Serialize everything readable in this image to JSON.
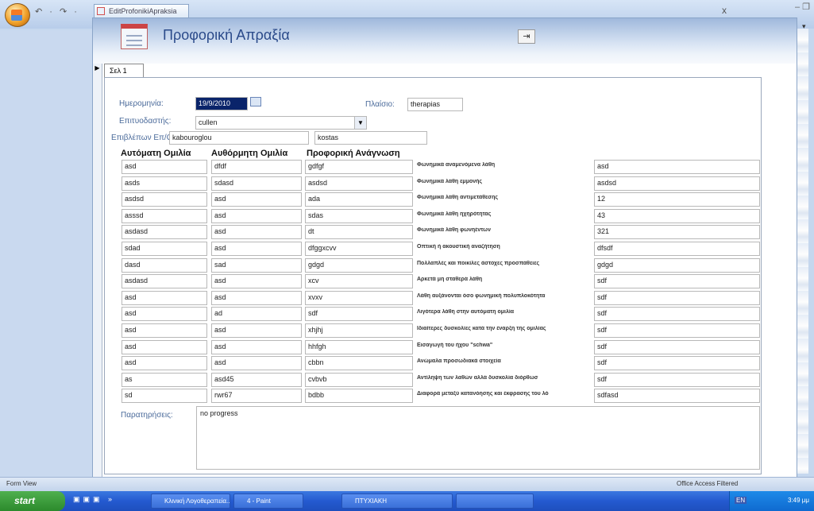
{
  "window": {
    "tab_title": "EditProfonikiApraksia",
    "close": "x"
  },
  "header": {
    "title": "Προφορική Απραξία",
    "exit_glyph": "⇥"
  },
  "page_tab": "Σελ 1",
  "record_marker": "▶",
  "fields": {
    "date_label": "Ημερομηνία:",
    "date_value": "19/9/2010",
    "context_label": "Πλαίσιο:",
    "context_value": "therapias",
    "therapist_label": "Επιτυοδαστής:",
    "therapist_value": "cullen",
    "supervisor_label": "Επιβλέπων Επ/Ον:",
    "supervisor_value_1": "kabouroglou",
    "supervisor_value_2": "kostas"
  },
  "columns": {
    "auto_header": "Αυτόματη Ομιλία",
    "voluntary_header": "Αυθόρμητη Ομιλία",
    "reading_header": "Προφορική Ανάγνωση"
  },
  "rows": [
    {
      "auto": "asd",
      "vol": "dfdf",
      "read": "gdfgf",
      "criterion": "Φωνημικά αναμενόμενα λάθη",
      "value": "asd"
    },
    {
      "auto": "asds",
      "vol": "sdasd",
      "read": "asdsd",
      "criterion": "Φωνημικά λάθη εμμονής",
      "value": "asdsd"
    },
    {
      "auto": "asdsd",
      "vol": "asd",
      "read": "ada",
      "criterion": "Φωνημικά λάθη αντιμετάθεσης",
      "value": "12"
    },
    {
      "auto": "asssd",
      "vol": "asd",
      "read": "sdas",
      "criterion": "Φωνημικά λάθη ηχηρότητας",
      "value": "43"
    },
    {
      "auto": "asdasd",
      "vol": "asd",
      "read": "dt",
      "criterion": "Φωνημικά λάθη φωνηέντων",
      "value": "321"
    },
    {
      "auto": "sdad",
      "vol": "asd",
      "read": "dfggxcvv",
      "criterion": "Οπτική ή ακουστική αναζήτηση",
      "value": "dfsdf"
    },
    {
      "auto": "dasd",
      "vol": "sad",
      "read": "gdgd",
      "criterion": "Πολλαπλές και ποικίλες άστοχες προσπάθειες",
      "value": "gdgd"
    },
    {
      "auto": "asdasd",
      "vol": "asd",
      "read": "xcv",
      "criterion": "Αρκετά μη σταθερά λάθη",
      "value": "sdf"
    },
    {
      "auto": "asd",
      "vol": "asd",
      "read": "xvxv",
      "criterion": "Λάθη αυξάνονται όσο φωνημική πολυπλοκότητα",
      "value": "sdf"
    },
    {
      "auto": "asd",
      "vol": "ad",
      "read": "sdf",
      "criterion": "Λιγότερα λάθη στην αυτόματη ομιλία",
      "value": "sdf"
    },
    {
      "auto": "asd",
      "vol": "asd",
      "read": "xhjhj",
      "criterion": "Ιδιαίτερες δυσκολίες κατά την έναρξη της ομιλίας",
      "value": "sdf"
    },
    {
      "auto": "asd",
      "vol": "asd",
      "read": "hhfgh",
      "criterion": "Εισαγωγή του ήχου \"schwa\"",
      "value": "sdf"
    },
    {
      "auto": "asd",
      "vol": "asd",
      "read": "cbbn",
      "criterion": "Ανώμαλα προσωδιακά στοιχεία",
      "value": "sdf"
    },
    {
      "auto": "as",
      "vol": "asd45",
      "read": "cvbvb",
      "criterion": "Αντίληψη των λαθών αλλά δυσκολία διόρθωσ",
      "value": "sdf"
    },
    {
      "auto": "sd",
      "vol": "rwr67",
      "read": "bdbb",
      "criterion": "Διαφορά μεταξύ κατανόησης και έκφρασης του λό",
      "value": "sdfasd"
    }
  ],
  "notes": {
    "label": "Παρατηρήσεις:",
    "value": "no progress"
  },
  "status": {
    "left": "Form View",
    "right": "Office Access  Filtered"
  },
  "taskbar": {
    "start": "start",
    "tasks": [
      "Κλινική Λογοθεραπεία...",
      "4 - Paint",
      "ΠΤΥΧΙΑΚΗ",
      ""
    ],
    "lang": "EN",
    "clock": "3:49 μμ"
  },
  "colors": {
    "title": "#2a4a8a",
    "label": "#4a6a9a",
    "taskbar": "#245ad0",
    "start": "#2c8a2c"
  }
}
